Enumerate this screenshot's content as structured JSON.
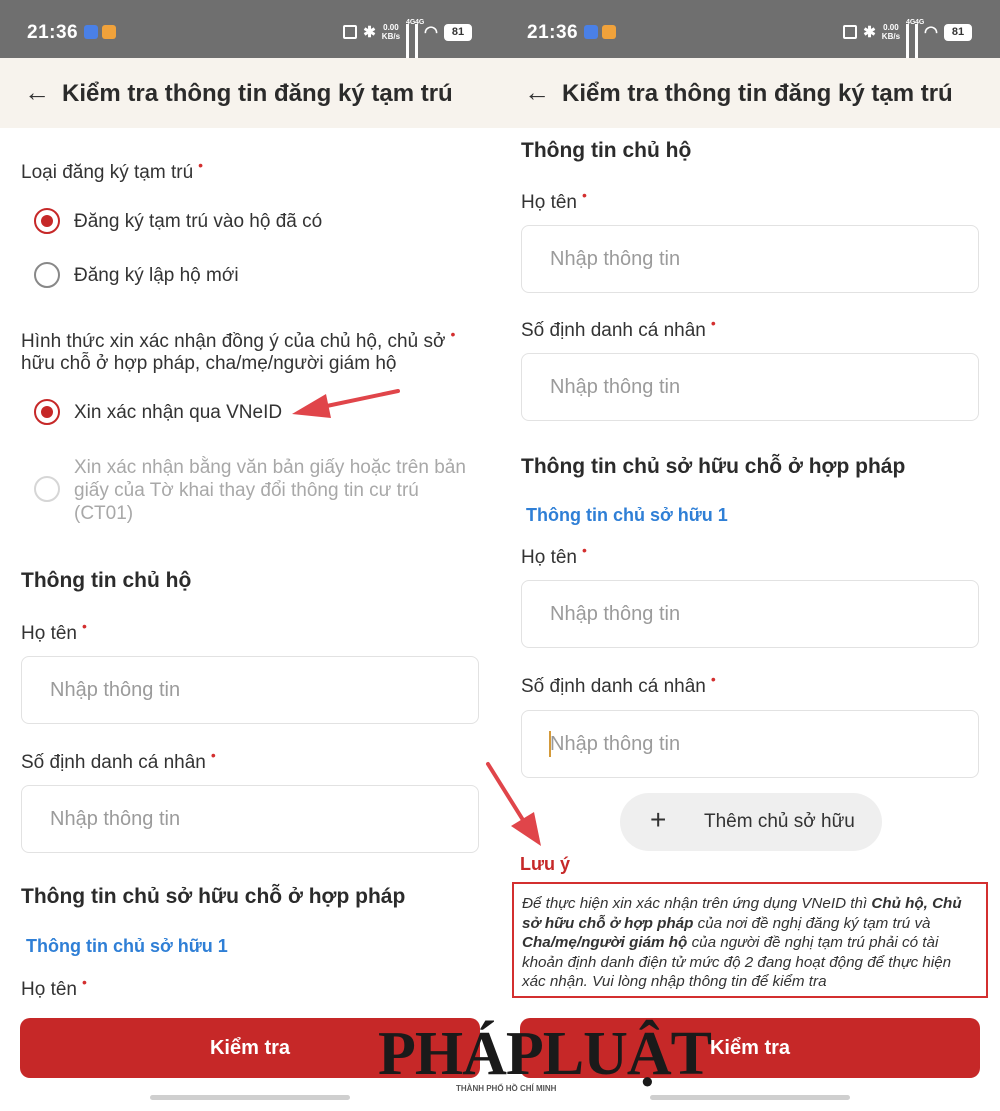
{
  "status_bar": {
    "time": "21:36",
    "net_speed": "0.00",
    "net_unit": "KB/s",
    "signal_1": "4G",
    "signal_2": "4G",
    "battery": "81"
  },
  "app_bar": {
    "back_icon": "arrow-left-icon",
    "title": "Kiểm tra thông tin đăng ký tạm trú"
  },
  "left_screen": {
    "registration_type": {
      "label": "Loại đăng ký tạm trú",
      "required_mark": "•",
      "options": [
        {
          "label": "Đăng ký tạm trú vào hộ đã có",
          "selected": true,
          "disabled": false
        },
        {
          "label": "Đăng ký lập hộ mới",
          "selected": false,
          "disabled": false
        }
      ]
    },
    "consent_method": {
      "label_line1": "Hình thức xin xác nhận đồng ý của chủ hộ, chủ sở",
      "label_line2": "hữu chỗ ở hợp pháp, cha/mẹ/người giám hộ",
      "required_mark": "•",
      "options": [
        {
          "label": "Xin xác nhận qua VNeID",
          "selected": true,
          "disabled": false
        },
        {
          "label_line1": "Xin xác nhận bằng văn bản giấy hoặc trên bản",
          "label_line2": "giấy của Tờ khai thay đổi thông tin cư trú",
          "label_line3": "(CT01)",
          "selected": false,
          "disabled": true
        }
      ]
    },
    "household_head_section": "Thông tin chủ hộ",
    "name_label": "Họ tên",
    "name_placeholder": "Nhập thông tin",
    "id_label": "Số định danh cá nhân",
    "id_placeholder": "Nhập thông tin",
    "owner_section": "Thông tin chủ sở hữu chỗ ở hợp pháp",
    "owner_sub": "Thông tin chủ sở hữu 1",
    "owner_name_label": "Họ tên",
    "submit_label": "Kiểm tra"
  },
  "right_screen": {
    "household_head_section": "Thông tin chủ hộ",
    "name_label": "Họ tên",
    "name_placeholder": "Nhập thông tin",
    "id_label": "Số định danh cá nhân",
    "id_placeholder": "Nhập thông tin",
    "owner_section": "Thông tin chủ sở hữu chỗ ở hợp pháp",
    "owner_sub": "Thông tin chủ sở hữu 1",
    "owner_name_label": "Họ tên",
    "owner_name_placeholder": "Nhập thông tin",
    "owner_id_label": "Số định danh cá nhân",
    "owner_id_placeholder": "Nhập thông tin",
    "add_owner_label": "Thêm chủ sở hữu",
    "add_owner_icon": "plus-icon",
    "note_title": "Lưu ý",
    "note": {
      "part1": "Để thực hiện xin xác nhận trên ứng dụng VNeID thì ",
      "bold1": "Chủ hộ, Chủ sở hữu chỗ ở hợp pháp",
      "part2": " của nơi đề nghị đăng ký tạm trú và ",
      "bold2": "Cha/mẹ/người giám hộ",
      "part3": " của người đề nghị tạm trú phải có tài khoản định danh điện tử mức độ 2 đang hoạt động để thực hiện xác nhận. Vui lòng nhập thông tin để kiểm tra"
    },
    "submit_label": "Kiểm tra"
  },
  "watermark": {
    "text": "PHÁPLUẬT",
    "sub": "THÀNH PHỐ HỒ CHÍ MINH"
  },
  "colors": {
    "primary": "#c62828",
    "link": "#2f7fd6",
    "status_bar": "#6f6f6f",
    "app_bar": "#f7f3ed",
    "annotation_arrow": "#e0454a"
  }
}
